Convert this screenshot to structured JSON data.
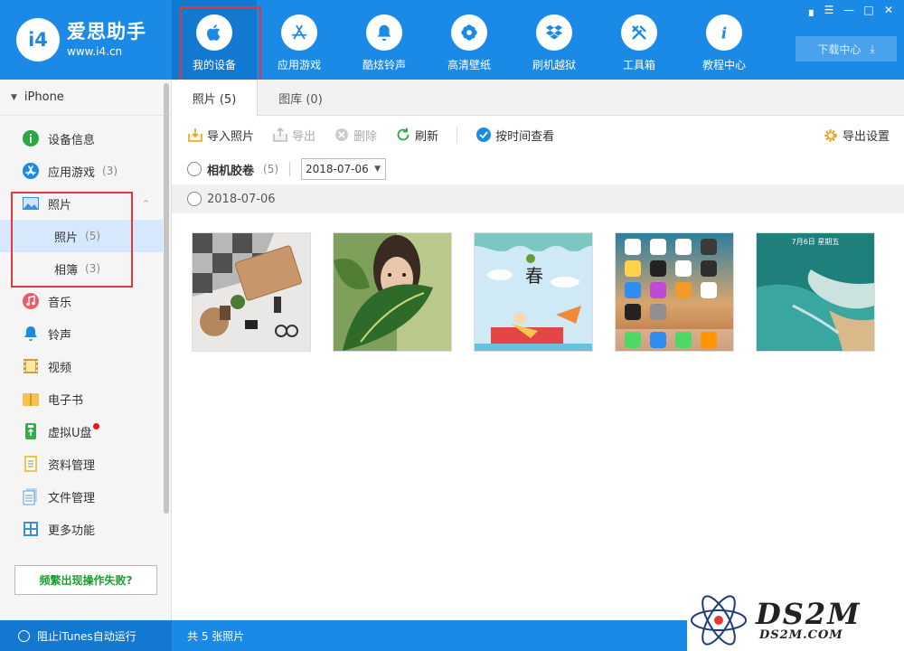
{
  "app": {
    "name": "爱思助手",
    "url": "www.i4.cn",
    "logo_mark": "i4"
  },
  "nav": [
    {
      "label": "我的设备",
      "icon": "apple-icon",
      "active": true
    },
    {
      "label": "应用游戏",
      "icon": "app-store-icon"
    },
    {
      "label": "酷炫铃声",
      "icon": "bell-icon"
    },
    {
      "label": "高清壁纸",
      "icon": "flower-icon"
    },
    {
      "label": "刷机越狱",
      "icon": "dropbox-icon"
    },
    {
      "label": "工具箱",
      "icon": "tools-icon"
    },
    {
      "label": "教程中心",
      "icon": "info-icon"
    }
  ],
  "window_controls": [
    "shirt-icon",
    "menu-icon",
    "minimize-icon",
    "maximize-icon",
    "close-icon"
  ],
  "download_center": "下载中心",
  "sidebar": {
    "device": "iPhone",
    "items": [
      {
        "label": "设备信息",
        "icon": "info-green-icon"
      },
      {
        "label": "应用游戏",
        "icon": "app-store-blue-icon",
        "count": "(3)"
      },
      {
        "label": "照片",
        "icon": "photo-icon"
      },
      {
        "label": "照片",
        "count": "(5)",
        "sub": true,
        "selected": true
      },
      {
        "label": "相簿",
        "count": "(3)",
        "sub": true
      },
      {
        "label": "音乐",
        "icon": "music-icon"
      },
      {
        "label": "铃声",
        "icon": "bell-blue-icon"
      },
      {
        "label": "视频",
        "icon": "film-icon"
      },
      {
        "label": "电子书",
        "icon": "book-icon"
      },
      {
        "label": "虚拟U盘",
        "icon": "usb-icon",
        "badge": true
      },
      {
        "label": "资料管理",
        "icon": "contacts-icon"
      },
      {
        "label": "文件管理",
        "icon": "files-icon"
      },
      {
        "label": "更多功能",
        "icon": "grid-icon"
      }
    ],
    "help_button": "频繁出现操作失败?"
  },
  "tabs": [
    {
      "label": "照片 (5)",
      "active": true
    },
    {
      "label": "图库 (0)"
    }
  ],
  "toolbar": {
    "import": "导入照片",
    "export": "导出",
    "delete": "删除",
    "refresh": "刷新",
    "by_time": "按时间查看",
    "export_settings": "导出设置"
  },
  "filter": {
    "album": "相机胶卷",
    "count": "(5)",
    "date": "2018-07-06"
  },
  "group_date": "2018-07-06",
  "photos": [
    {
      "desc": "desk-flatlay-photo"
    },
    {
      "desc": "girl-with-leaf-photo"
    },
    {
      "desc": "cartoon-summer-photo",
      "text": "春"
    },
    {
      "desc": "ios-homescreen-photo"
    },
    {
      "desc": "lockscreen-beach-photo",
      "text": "7月6日 星期五"
    }
  ],
  "status": {
    "itunes": "阻止iTunes自动运行",
    "total": "共 5 张照片"
  },
  "watermark": {
    "big": "DS2M",
    "small": "DS2M.COM"
  }
}
